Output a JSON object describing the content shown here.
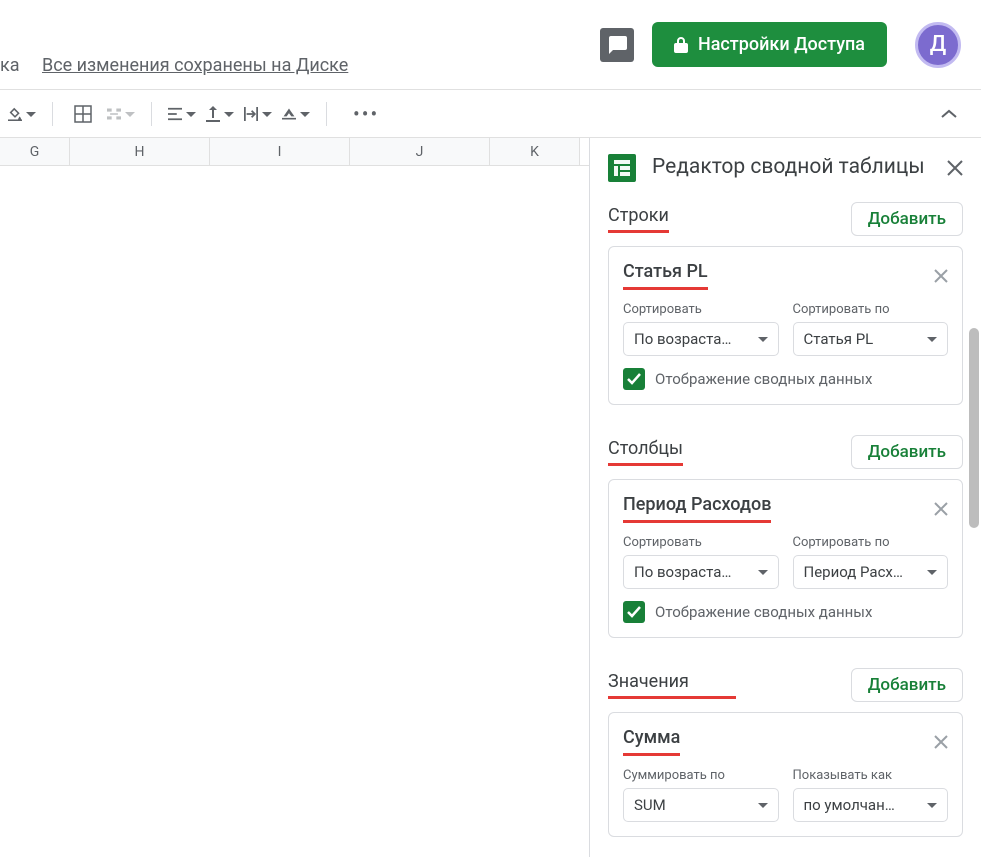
{
  "topbar": {
    "ka": "ка",
    "saved_msg": "Все изменения сохранены на Диске",
    "share_label": "Настройки Доступа",
    "avatar_letter": "Д"
  },
  "columns": [
    "G",
    "H",
    "I",
    "J",
    "K"
  ],
  "panel": {
    "title": "Редактор сводной таблицы",
    "add_label": "Добавить",
    "sections": {
      "rows": {
        "label": "Строки"
      },
      "cols": {
        "label": "Столбцы"
      },
      "vals": {
        "label": "Значения"
      }
    },
    "card_rows": {
      "title": "Статья PL",
      "sort_label": "Сортировать",
      "sort_value": "По возраста…",
      "sortby_label": "Сортировать по",
      "sortby_value": "Статья PL",
      "show_totals": "Отображение сводных данных"
    },
    "card_cols": {
      "title": "Период Расходов",
      "sort_label": "Сортировать",
      "sort_value": "По возраста…",
      "sortby_label": "Сортировать по",
      "sortby_value": "Период Расх…",
      "show_totals": "Отображение сводных данных"
    },
    "card_vals": {
      "title": "Сумма",
      "summ_label": "Суммировать по",
      "summ_value": "SUM",
      "show_label": "Показывать как",
      "show_value": "по умолчан…"
    }
  }
}
